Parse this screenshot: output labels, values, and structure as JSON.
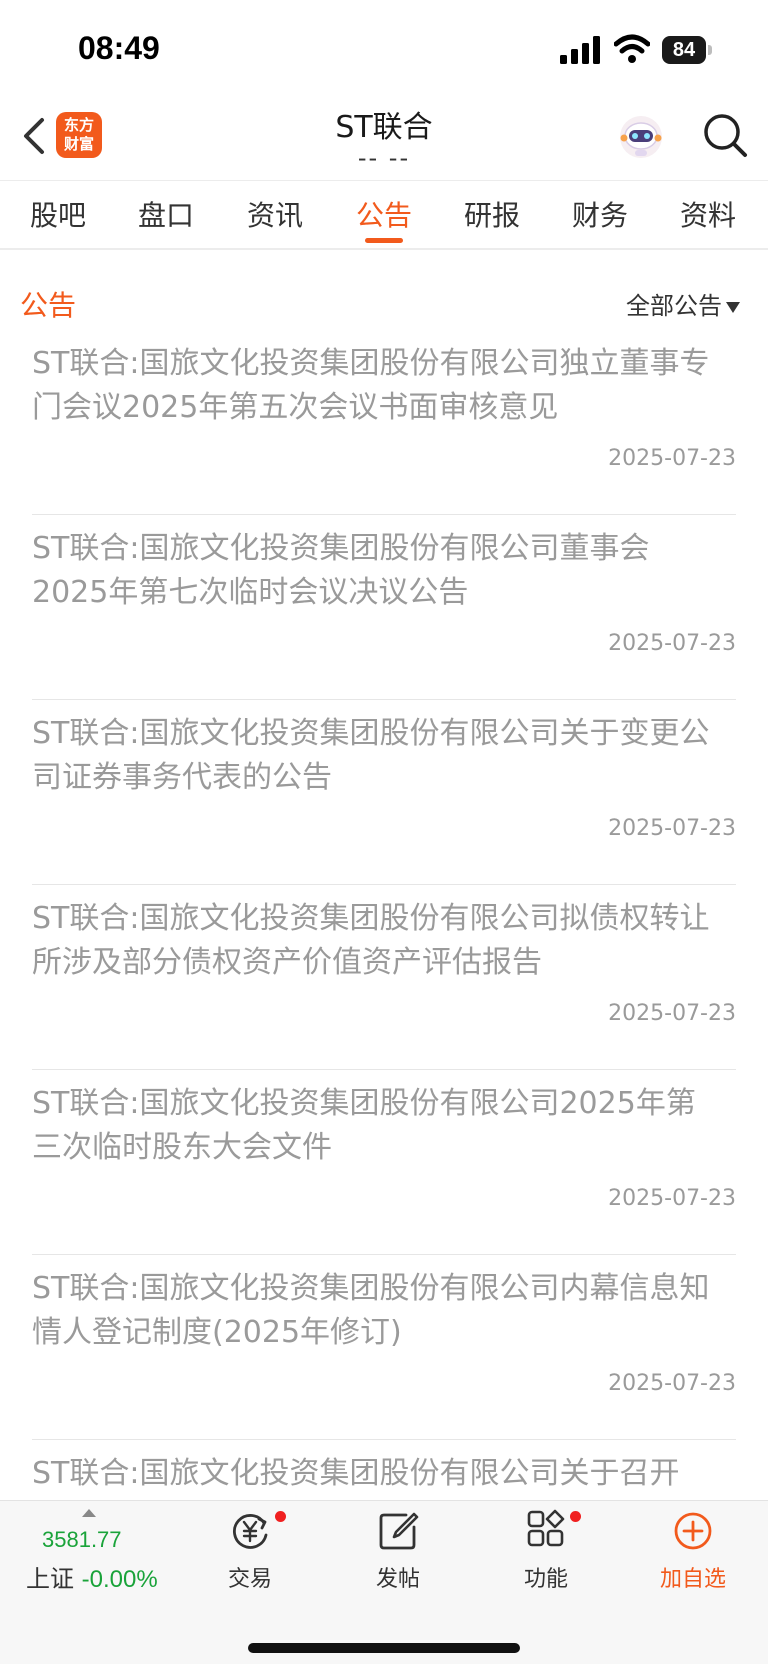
{
  "status_bar": {
    "time": "08:49",
    "battery": "84"
  },
  "header": {
    "logo_line1": "东方",
    "logo_line2": "财富",
    "title": "ST联合",
    "subtitle": "-- --"
  },
  "tabs": [
    {
      "label": "股吧"
    },
    {
      "label": "盘口"
    },
    {
      "label": "资讯"
    },
    {
      "label": "公告"
    },
    {
      "label": "研报"
    },
    {
      "label": "财务"
    },
    {
      "label": "资料"
    }
  ],
  "active_tab": "公告",
  "section": {
    "title": "公告",
    "filter_label": "全部公告"
  },
  "notices": [
    {
      "title": "ST联合:国旅文化投资集团股份有限公司独立董事专门会议2025年第五次会议书面审核意见",
      "date": "2025-07-23"
    },
    {
      "title": "ST联合:国旅文化投资集团股份有限公司董事会2025年第七次临时会议决议公告",
      "date": "2025-07-23"
    },
    {
      "title": "ST联合:国旅文化投资集团股份有限公司关于变更公司证券事务代表的公告",
      "date": "2025-07-23"
    },
    {
      "title": "ST联合:国旅文化投资集团股份有限公司拟债权转让所涉及部分债权资产价值资产评估报告",
      "date": "2025-07-23"
    },
    {
      "title": "ST联合:国旅文化投资集团股份有限公司2025年第三次临时股东大会文件",
      "date": "2025-07-23"
    },
    {
      "title": "ST联合:国旅文化投资集团股份有限公司内幕信息知情人登记制度(2025年修订)",
      "date": "2025-07-23"
    },
    {
      "title": "ST联合:国旅文化投资集团股份有限公司关于召开",
      "date": ""
    }
  ],
  "bottom_bar": {
    "index_value": "3581.77",
    "index_name": "上证",
    "index_change": "-0.00%",
    "trade_label": "交易",
    "post_label": "发帖",
    "functions_label": "功能",
    "add_watchlist_label": "加自选"
  },
  "colors": {
    "accent": "#f25a1c",
    "up_down_green": "#1aa33a",
    "muted_text": "#9a9a9a",
    "badge_red": "#f02020"
  }
}
